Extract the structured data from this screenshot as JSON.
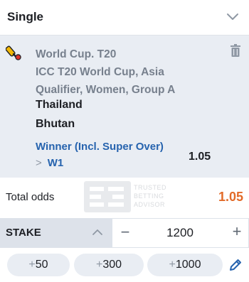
{
  "bet_type": {
    "label": "Single"
  },
  "bet": {
    "tournament": "World Cup. T20\nICC T20 World Cup, Asia\nQualifier, Women, Group A",
    "team1": "Thailand",
    "team2": "Bhutan",
    "market": "Winner (Incl. Super Over)",
    "outcome": "W1",
    "odds": "1.05"
  },
  "total": {
    "label": "Total odds",
    "value": "1.05"
  },
  "watermark": {
    "line1": "TRUSTED",
    "line2": "BETTING",
    "line3": "ADVISOR"
  },
  "stake": {
    "label": "STAKE",
    "minus": "−",
    "value": "1200",
    "plus": "+"
  },
  "quick_stakes": [
    {
      "plus": "+",
      "amount": "50"
    },
    {
      "plus": "+",
      "amount": "300"
    },
    {
      "plus": "+",
      "amount": "1000"
    }
  ],
  "colors": {
    "accent_orange": "#e26a28",
    "link_blue": "#2663ae",
    "muted_gray": "#77808d",
    "panel": "#e9edf3"
  },
  "icons": {
    "bet_type": "chevron-down-icon",
    "sport": "cricket-icon",
    "remove": "trash-icon",
    "collapse": "chevron-up-icon",
    "edit": "pencil-icon"
  }
}
